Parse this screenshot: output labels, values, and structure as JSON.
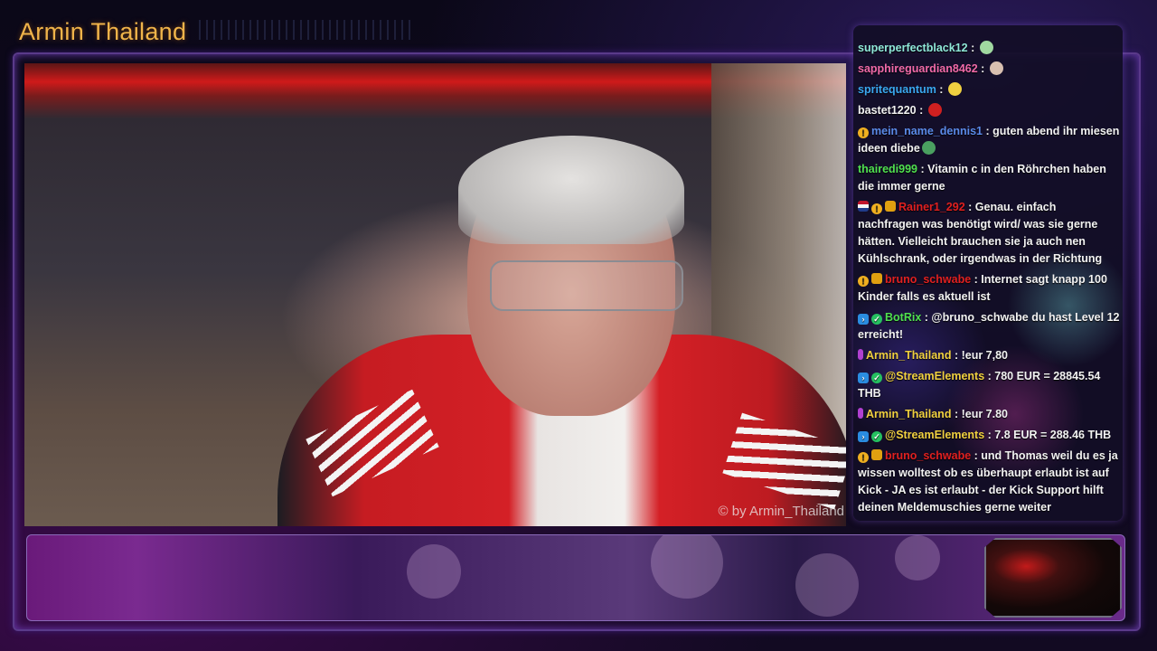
{
  "channel": {
    "title": "Armin Thailand"
  },
  "video": {
    "watermark": "© by Armin_Thailand"
  },
  "colors": {
    "title": "#f0b44a",
    "chat_bg": "#12102a",
    "frame_accent": "#5a3a8a"
  },
  "chat": {
    "messages": [
      {
        "user": "superperfectblack12",
        "user_color": "#8fe8d8",
        "badges": [],
        "text": "",
        "emote": "ghost-emote",
        "emote_color": "#a0d8a0"
      },
      {
        "user": "sapphireguardian8462",
        "user_color": "#f06aa8",
        "badges": [],
        "text": "",
        "emote": "face-emote",
        "emote_color": "#d8c0b0"
      },
      {
        "user": "spritequantum",
        "user_color": "#3aa8f0",
        "badges": [],
        "text": "",
        "emote": "banana-emote",
        "emote_color": "#f0d040"
      },
      {
        "user": "bastet1220",
        "user_color": "#f2f2f2",
        "badges": [],
        "text": "",
        "emote": "red-emote",
        "emote_color": "#d02020"
      },
      {
        "user": "mein_name_dennis1",
        "user_color": "#5a8ae8",
        "badges": [
          "info"
        ],
        "text": "guten abend ihr miesen ideen diebe",
        "emote": "frog-emote",
        "emote_color": "#4aa060"
      },
      {
        "user": "thairedi999",
        "user_color": "#50e050",
        "badges": [],
        "text": "Vitamin c in den Röhrchen haben die immer gerne",
        "emote": "",
        "emote_color": ""
      },
      {
        "user": "Rainer1_292",
        "user_color": "#e02020",
        "badges": [
          "flag",
          "info",
          "crown"
        ],
        "text": "Genau. einfach nachfragen was benötigt wird/ was sie gerne hätten. Vielleicht brauchen sie ja auch nen Kühlschrank, oder irgendwas in der Richtung",
        "emote": "",
        "emote_color": ""
      },
      {
        "user": "bruno_schwabe",
        "user_color": "#e02020",
        "badges": [
          "info",
          "crown"
        ],
        "text": "Internet sagt knapp 100 Kinder falls es aktuell ist",
        "emote": "",
        "emote_color": ""
      },
      {
        "user": "BotRix",
        "user_color": "#50e050",
        "badges": [
          "bot",
          "check"
        ],
        "text": "@bruno_schwabe du hast Level 12 erreicht!",
        "emote": "",
        "emote_color": ""
      },
      {
        "user": "Armin_Thailand",
        "user_color": "#f0d040",
        "badges": [
          "mic"
        ],
        "text": "!eur 7,80",
        "emote": "",
        "emote_color": ""
      },
      {
        "user": "@StreamElements",
        "user_color": "#f0d040",
        "badges": [
          "bot",
          "check"
        ],
        "text": "780 EUR = 28845.54 THB",
        "emote": "",
        "emote_color": ""
      },
      {
        "user": "Armin_Thailand",
        "user_color": "#f0d040",
        "badges": [
          "mic"
        ],
        "text": "!eur 7.80",
        "emote": "",
        "emote_color": ""
      },
      {
        "user": "@StreamElements",
        "user_color": "#f0d040",
        "badges": [
          "bot",
          "check"
        ],
        "text": "7.8 EUR = 288.46 THB",
        "emote": "",
        "emote_color": ""
      },
      {
        "user": "bruno_schwabe",
        "user_color": "#e02020",
        "badges": [
          "info",
          "crown"
        ],
        "text": "und Thomas weil du es ja wissen wolltest ob es überhaupt erlaubt ist auf Kick - JA es ist erlaubt - der Kick Support hilft deinen Meldemuschies gerne weiter",
        "emote": "",
        "emote_color": ""
      }
    ]
  }
}
